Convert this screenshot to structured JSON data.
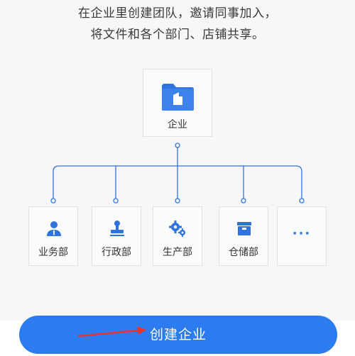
{
  "intro": {
    "line1": "在企业里创建团队，邀请同事加入，",
    "line2": "将文件和各个部门、店铺共享。"
  },
  "org": {
    "root_label": "企业",
    "departments": [
      {
        "label": "业务部",
        "icon": "person-icon"
      },
      {
        "label": "行政部",
        "icon": "stamp-icon"
      },
      {
        "label": "生产部",
        "icon": "gears-icon"
      },
      {
        "label": "仓储部",
        "icon": "warehouse-box-icon"
      }
    ],
    "more_label": "···"
  },
  "action": {
    "create_label": "创建企业"
  },
  "colors": {
    "accent": "#2c7bf0",
    "icon_blue": "#2f73df",
    "annotation_red": "#e8352c"
  }
}
